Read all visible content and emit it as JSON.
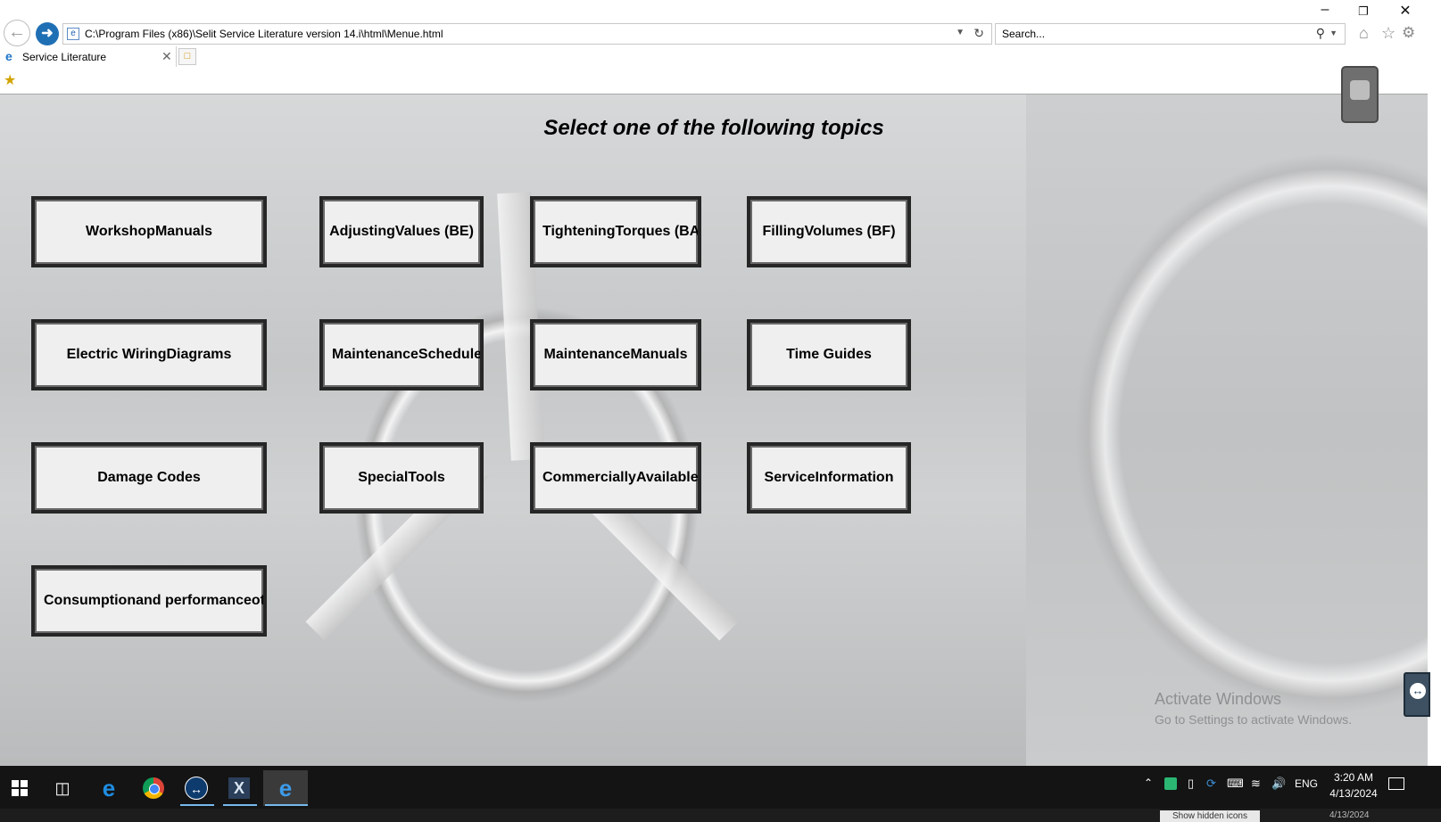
{
  "browser": {
    "address": "C:\\Program Files (x86)\\Selit Service Literature version 14.i\\html\\Menue.html",
    "search_placeholder": "Search...",
    "tab_title": "Service Literature"
  },
  "page": {
    "heading": "Select one of the following topics",
    "topics": [
      "WorkshopManuals",
      "AdjustingValues (BE)",
      "TighteningTorques (BA)",
      "FillingVolumes (BF)",
      "Electric WiringDiagrams",
      "MaintenanceSchedule",
      "MaintenanceManuals",
      "Time Guides",
      "Damage Codes",
      "SpecialTools",
      "CommerciallyAvailable Tools",
      "ServiceInformation",
      "Consumptionand performanceoti"
    ]
  },
  "watermark": {
    "line1": "Activate Windows",
    "line2": "Go to Settings to activate Windows."
  },
  "taskbar": {
    "language": "ENG",
    "time": "3:20 AM",
    "date": "4/13/2024",
    "tooltip": "Show hidden icons",
    "ghost_date": "4/13/2024"
  },
  "icons": {
    "back": "back-arrow-icon",
    "forward": "forward-arrow-icon",
    "home": "home-icon",
    "favorites": "star-icon",
    "settings": "gear-icon"
  }
}
